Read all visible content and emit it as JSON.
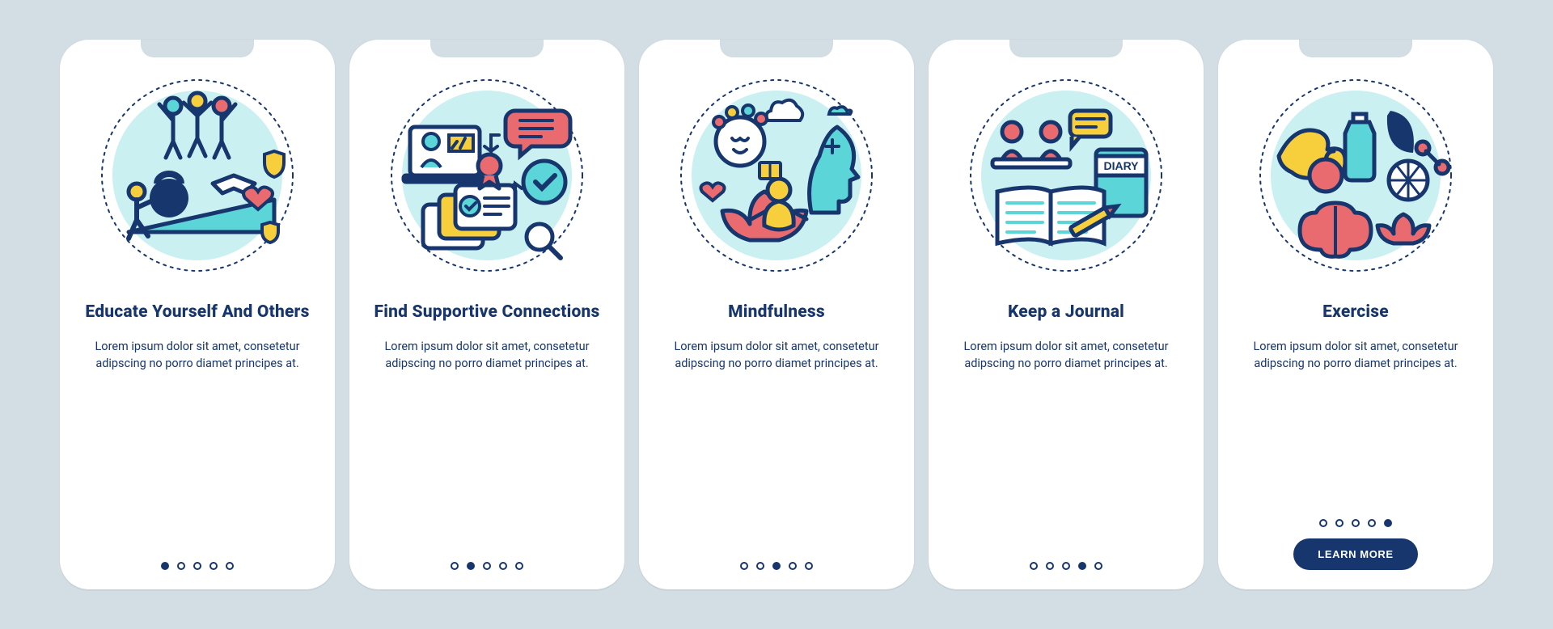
{
  "colors": {
    "background": "#d3dee4",
    "primary": "#17366d",
    "teal": "#5cd5d8",
    "yellow": "#f7cf3d",
    "coral": "#e96a6f",
    "tealLight": "#caf0f1"
  },
  "body_text": "Lorem ipsum dolor sit amet, consetetur adipscing no porro diamet principes at.",
  "cta_label": "LEARN MORE",
  "screens": [
    {
      "title": "Educate Yourself And Others",
      "icon_name": "teamwork-support-icon",
      "active_dot": 0,
      "show_cta": false
    },
    {
      "title": "Find Supportive Connections",
      "icon_name": "tasks-chat-icon",
      "active_dot": 1,
      "show_cta": false
    },
    {
      "title": "Mindfulness",
      "icon_name": "meditation-icon",
      "active_dot": 2,
      "show_cta": false
    },
    {
      "title": "Keep a Journal",
      "icon_name": "diary-journal-icon",
      "active_dot": 3,
      "show_cta": false
    },
    {
      "title": "Exercise",
      "icon_name": "fitness-health-icon",
      "active_dot": 4,
      "show_cta": true
    }
  ]
}
